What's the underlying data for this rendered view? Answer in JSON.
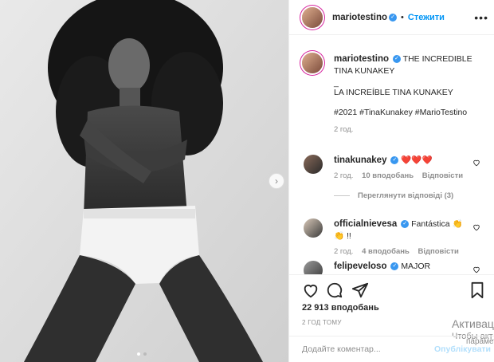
{
  "post": {
    "author": {
      "username": "mariotestino",
      "follow_label": "Стежити",
      "more_icon": "more-horizontal-icon"
    },
    "caption": {
      "username": "mariotestino",
      "line1": "THE INCREDIBLE TINA KUNAKEY",
      "separator": "_",
      "line2": "LA INCREÍBLE TINA KUNAKEY",
      "hashtags": "#2021 #TinaKunakey #MarioTestino",
      "time": "2 год."
    },
    "comments": [
      {
        "username": "tinakunakey",
        "text": "❤️❤️❤️",
        "time": "2 год.",
        "likes": "10 вподобань",
        "reply_label": "Відповісти",
        "view_replies": "Переглянути відповіді (3)"
      },
      {
        "username": "officialnievesa",
        "text": "Fantástica 👏👏 !!",
        "time": "2 год.",
        "likes": "4 вподобань",
        "reply_label": "Відповісти"
      },
      {
        "username": "felipeveloso",
        "text": "MAJOR"
      }
    ],
    "likes_count": "22 913 вподобань",
    "posted_ago": "2 ГОД ТОМУ",
    "comment_placeholder": "Додайте коментар...",
    "publish_label": "Опублікувати",
    "carousel": {
      "current": 1,
      "total": 2
    }
  },
  "windows_watermark": {
    "line1": "Активація",
    "line2": "Чтобы акт",
    "line3": "параметр"
  },
  "colors": {
    "accent": "#0095f6",
    "verified": "#3897f0",
    "heart": "#ed4956"
  }
}
